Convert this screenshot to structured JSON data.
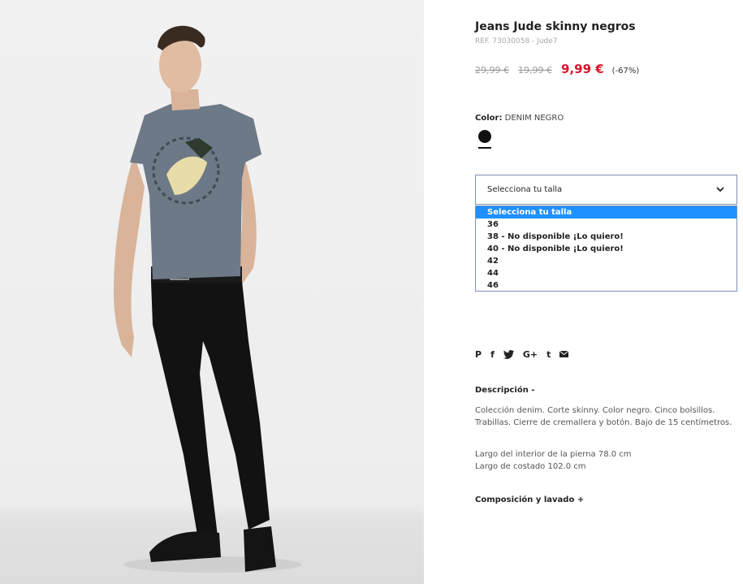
{
  "product": {
    "title": "Jeans Jude skinny negros",
    "ref": "REF. 73030058 - Jude7",
    "price_original": "29,99 €",
    "price_previous": "19,99 €",
    "price_current": "9,99 €",
    "discount": "(-67%)"
  },
  "color": {
    "label": "Color:",
    "value": "DENIM NEGRO",
    "swatch_color": "#111111"
  },
  "size_select": {
    "selected": "Selecciona tu talla",
    "options": [
      "Selecciona tu talla",
      "36",
      "38 - No disponible ¡Lo quiero!",
      "40 - No disponible ¡Lo quiero!",
      "42",
      "44",
      "46"
    ]
  },
  "share": {
    "icons": [
      "pinterest-icon",
      "facebook-icon",
      "twitter-icon",
      "google-plus-icon",
      "tumblr-icon",
      "email-icon"
    ],
    "pinterest": "P",
    "facebook": "f",
    "google_plus": "G+",
    "tumblr": "t"
  },
  "description": {
    "heading": "Descripción -",
    "text": "Colección denim. Corte skinny. Color negro. Cinco bolsillos. Trabillas. Cierre de cremallera y botón. Bajo de 15 centímetros.",
    "inseam": "Largo del interior de la pierna 78.0 cm",
    "side_length": "Largo de costado 102.0 cm"
  },
  "composition": {
    "label": "Composición y lavado +"
  },
  "colors": {
    "accent_red": "#d9142b",
    "select_highlight": "#1e90ff",
    "select_border": "#7b92b3"
  }
}
